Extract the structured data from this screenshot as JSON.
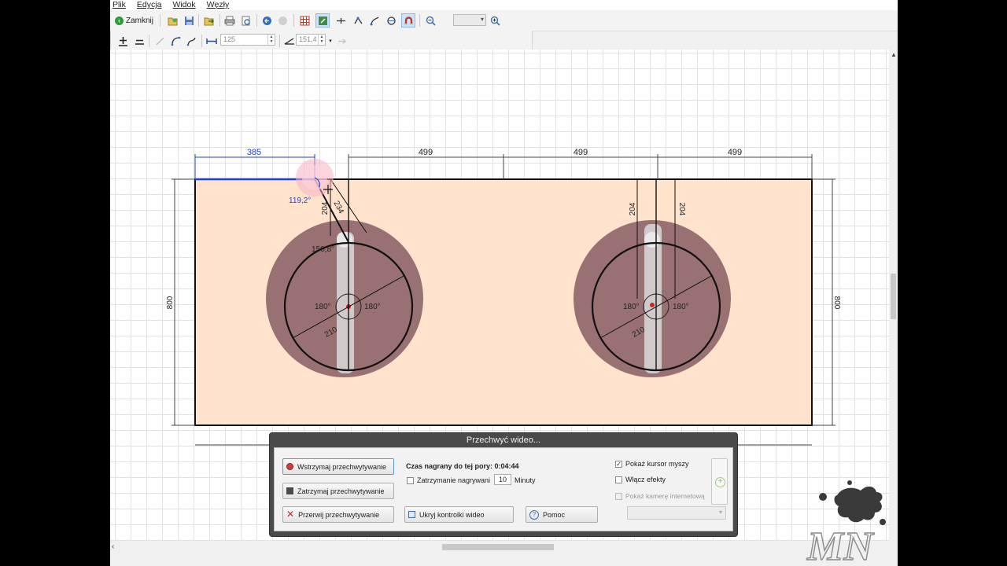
{
  "menu": [
    "Plik",
    "Edycja",
    "Widok",
    "Węzły"
  ],
  "toolbar": {
    "close_label": "Zamknij",
    "zoom_value": "",
    "length_value": "125",
    "angle_value": "151,4",
    "icons": [
      "back-icon",
      "open-icon",
      "save-icon",
      "export-icon",
      "print-icon",
      "print-preview-icon",
      "undo-icon",
      "redo-icon",
      "grid-icon",
      "snap-icon",
      "center-icon",
      "align-icon",
      "nodes-icon",
      "node-type-icon",
      "magnet-icon",
      "zoom-out-icon",
      "zoom-in-icon"
    ]
  },
  "drawing": {
    "dims_top": [
      "385",
      "499",
      "499",
      "499"
    ],
    "angle_label": "119,2°",
    "height_label": "800",
    "sink_dims": {
      "v1": "204",
      "diag": "234",
      "v2": "204",
      "deg150": "150,8°",
      "deg180": "180°",
      "deg180b": "180°",
      "diam": "210"
    }
  },
  "recorder": {
    "title": "Przechwyć wideo...",
    "pause_label": "Wstrzymaj przechwytywanie",
    "stop_label": "Zatrzymaj przechwytywanie",
    "cancel_label": "Przerwij przechwytywanie",
    "recorded_label": "Czas nagrany do tej pory: 0:04:44",
    "stop_after_label": "Zatrzymanie nagrywani",
    "minutes_value": "10",
    "minutes_label": "Minuty",
    "hide_label": "Ukryj kontrolki wideo",
    "help_label": "Pomoc",
    "show_cursor_label": "Pokaż kursor myszy",
    "show_cursor_checked": true,
    "effects_label": "Włącz efekty",
    "effects_checked": false,
    "webcam_label": "Pokaż kamerę internetową",
    "webcam_checked": false
  },
  "watermark": "MN"
}
